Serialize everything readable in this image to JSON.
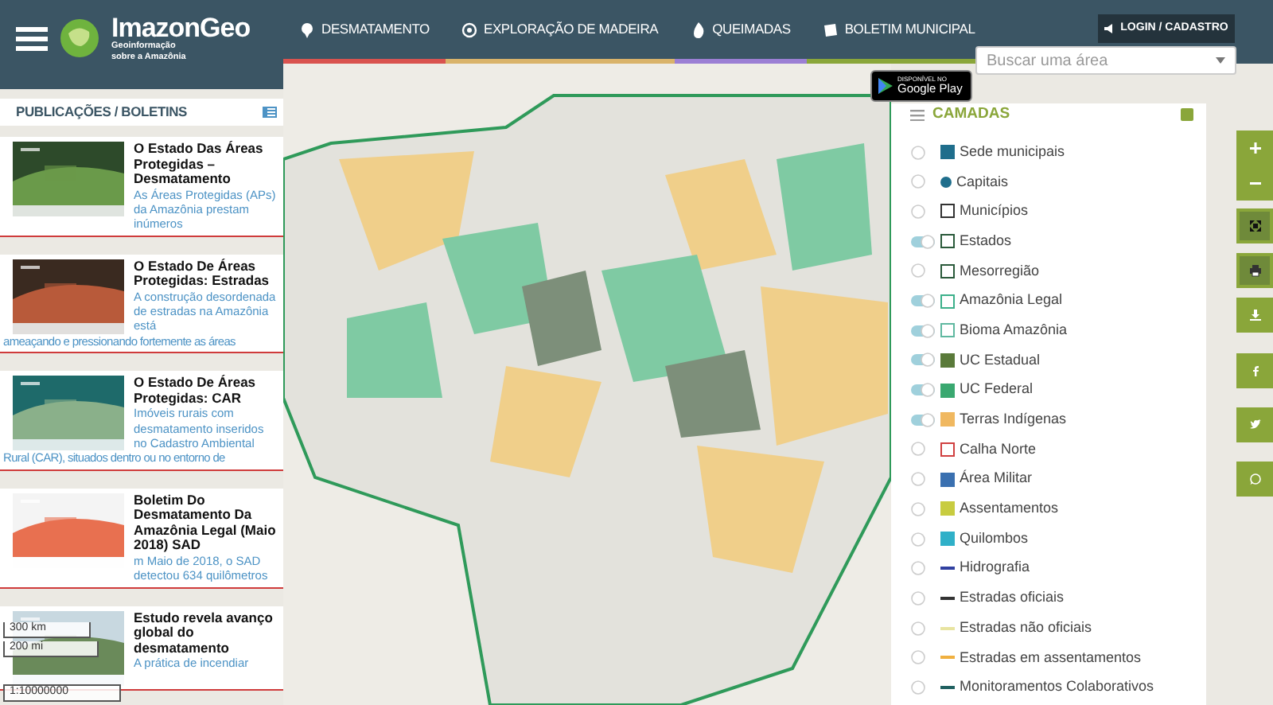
{
  "header": {
    "logo": {
      "name": "ImazonGeo",
      "tagline_1": "Geoinformação",
      "tagline_2": "sobre a Amazônia"
    },
    "nav": [
      {
        "label": "DESMATAMENTO",
        "color": "#d9534f"
      },
      {
        "label": "EXPLORAÇÃO DE MADEIRA",
        "color": "#d9b36a"
      },
      {
        "label": "QUEIMADAS",
        "color": "#9b7fd4"
      },
      {
        "label": "BOLETIM MUNICIPAL",
        "color": "#8aa63a"
      }
    ],
    "login": "LOGIN / CADASTRO",
    "search": {
      "placeholder": "Buscar uma área"
    }
  },
  "sidebar": {
    "title": "PUBLICAÇÕES / BOLETINS",
    "items": [
      {
        "title": "O Estado Das Áreas Protegidas – Desmatamento",
        "text": "As Áreas Protegidas (APs) da Amazônia prestam inúmeros"
      },
      {
        "title": "O Estado De Áreas Protegidas: Estradas",
        "text": "A construção desordenada de estradas na Amazônia está",
        "tail": "ameaçando e pressionando fortemente as áreas"
      },
      {
        "title": "O Estado De Áreas Protegidas: CAR",
        "text": "Imóveis rurais com desmatamento inseridos no Cadastro Ambiental",
        "tail": "Rural (CAR), situados dentro ou no entorno de"
      },
      {
        "title": "Boletim Do Desmatamento Da Amazônia Legal (Maio 2018) SAD",
        "text": "m Maio de 2018, o SAD detectou 634 quilômetros"
      },
      {
        "title": "Estudo revela avanço global do desmatamento",
        "text": "A prática de incendiar"
      }
    ]
  },
  "scale": {
    "km": "300 km",
    "mi": "200 mi",
    "ratio": "1:10000000"
  },
  "store_badge": {
    "small": "DISPONÍVEL NO",
    "big": "Google Play"
  },
  "layers": {
    "title": "CAMADAS",
    "items": [
      {
        "label": "Sede municipais",
        "on": false,
        "kind": "square",
        "color": "#1f6e8c"
      },
      {
        "label": "Capitais",
        "on": false,
        "kind": "dot",
        "color": "#1f6e8c"
      },
      {
        "label": "Municípios",
        "on": false,
        "kind": "outline",
        "color": "#333333"
      },
      {
        "label": "Estados",
        "on": true,
        "kind": "outline",
        "color": "#2a5a3a"
      },
      {
        "label": "Mesorregião",
        "on": false,
        "kind": "outline",
        "color": "#2a5a3a"
      },
      {
        "label": "Amazônia Legal",
        "on": true,
        "kind": "outline",
        "color": "#3cb08a"
      },
      {
        "label": "Bioma Amazônia",
        "on": true,
        "kind": "outline",
        "color": "#5fb8a0"
      },
      {
        "label": "UC Estadual",
        "on": true,
        "kind": "square",
        "color": "#5a7a3a"
      },
      {
        "label": "UC Federal",
        "on": true,
        "kind": "square",
        "color": "#3aa870"
      },
      {
        "label": "Terras Indígenas",
        "on": true,
        "kind": "square",
        "color": "#f0b860"
      },
      {
        "label": "Calha Norte",
        "on": false,
        "kind": "outline",
        "color": "#d04040"
      },
      {
        "label": "Área Militar",
        "on": false,
        "kind": "square",
        "color": "#3a70b0"
      },
      {
        "label": "Assentamentos",
        "on": false,
        "kind": "square",
        "color": "#c8cc40"
      },
      {
        "label": "Quilombos",
        "on": false,
        "kind": "square",
        "color": "#30b0c8"
      },
      {
        "label": "Hidrografia",
        "on": false,
        "kind": "line",
        "color": "#3040a0"
      },
      {
        "label": "Estradas oficiais",
        "on": false,
        "kind": "line",
        "color": "#333333"
      },
      {
        "label": "Estradas não oficiais",
        "on": false,
        "kind": "line",
        "color": "#e8e4a0"
      },
      {
        "label": "Estradas em assentamentos",
        "on": false,
        "kind": "line",
        "color": "#f0b040"
      },
      {
        "label": "Monitoramentos Colaborativos",
        "on": false,
        "kind": "line",
        "color": "#206060"
      }
    ]
  }
}
